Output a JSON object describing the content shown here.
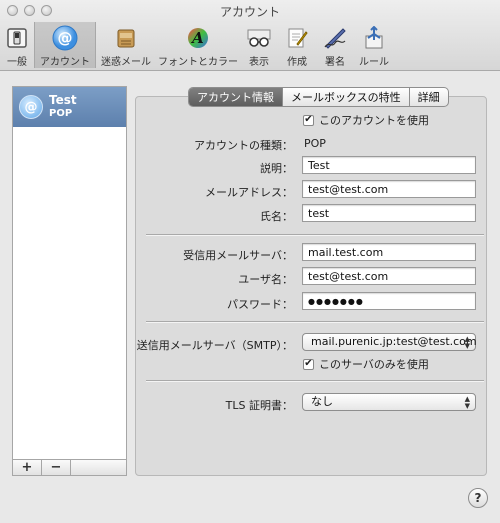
{
  "window": {
    "title": "アカウント"
  },
  "toolbar": {
    "items": [
      {
        "label": "一般",
        "icon": "switch-icon"
      },
      {
        "label": "アカウント",
        "icon": "at-icon"
      },
      {
        "label": "迷惑メール",
        "icon": "junk-mail-icon"
      },
      {
        "label": "フォントとカラー",
        "icon": "font-color-icon"
      },
      {
        "label": "表示",
        "icon": "glasses-icon"
      },
      {
        "label": "作成",
        "icon": "compose-icon"
      },
      {
        "label": "署名",
        "icon": "signature-icon"
      },
      {
        "label": "ルール",
        "icon": "rules-icon"
      }
    ]
  },
  "sidebar": {
    "account": {
      "name": "Test",
      "type": "POP"
    },
    "add_label": "+",
    "remove_label": "−"
  },
  "tabs": {
    "info": "アカウント情報",
    "mailbox": "メールボックスの特性",
    "detail": "詳細"
  },
  "form": {
    "enable_label": "このアカウントを使用",
    "enable_checked": true,
    "account_type_label": "アカウントの種類：",
    "account_type_value": "POP",
    "description_label": "説明：",
    "description_value": "Test",
    "email_label": "メールアドレス：",
    "email_value": "test@test.com",
    "fullname_label": "氏名：",
    "fullname_value": "test",
    "incoming_label": "受信用メールサーバ：",
    "incoming_value": "mail.test.com",
    "username_label": "ユーザ名：",
    "username_value": "test@test.com",
    "password_label": "パスワード：",
    "password_value": "●●●●●●●",
    "smtp_label": "送信用メールサーバ（SMTP）：",
    "smtp_value": "mail.purenic.jp:test@test.com",
    "only_server_label": "このサーバのみを使用",
    "only_server_checked": true,
    "tls_label": "TLS 証明書：",
    "tls_value": "なし"
  },
  "help": {
    "label": "?"
  },
  "colors": {
    "selection": "#6d8fbb",
    "tab_active": "#6c6c6c",
    "panel": "#dcdcdc"
  }
}
